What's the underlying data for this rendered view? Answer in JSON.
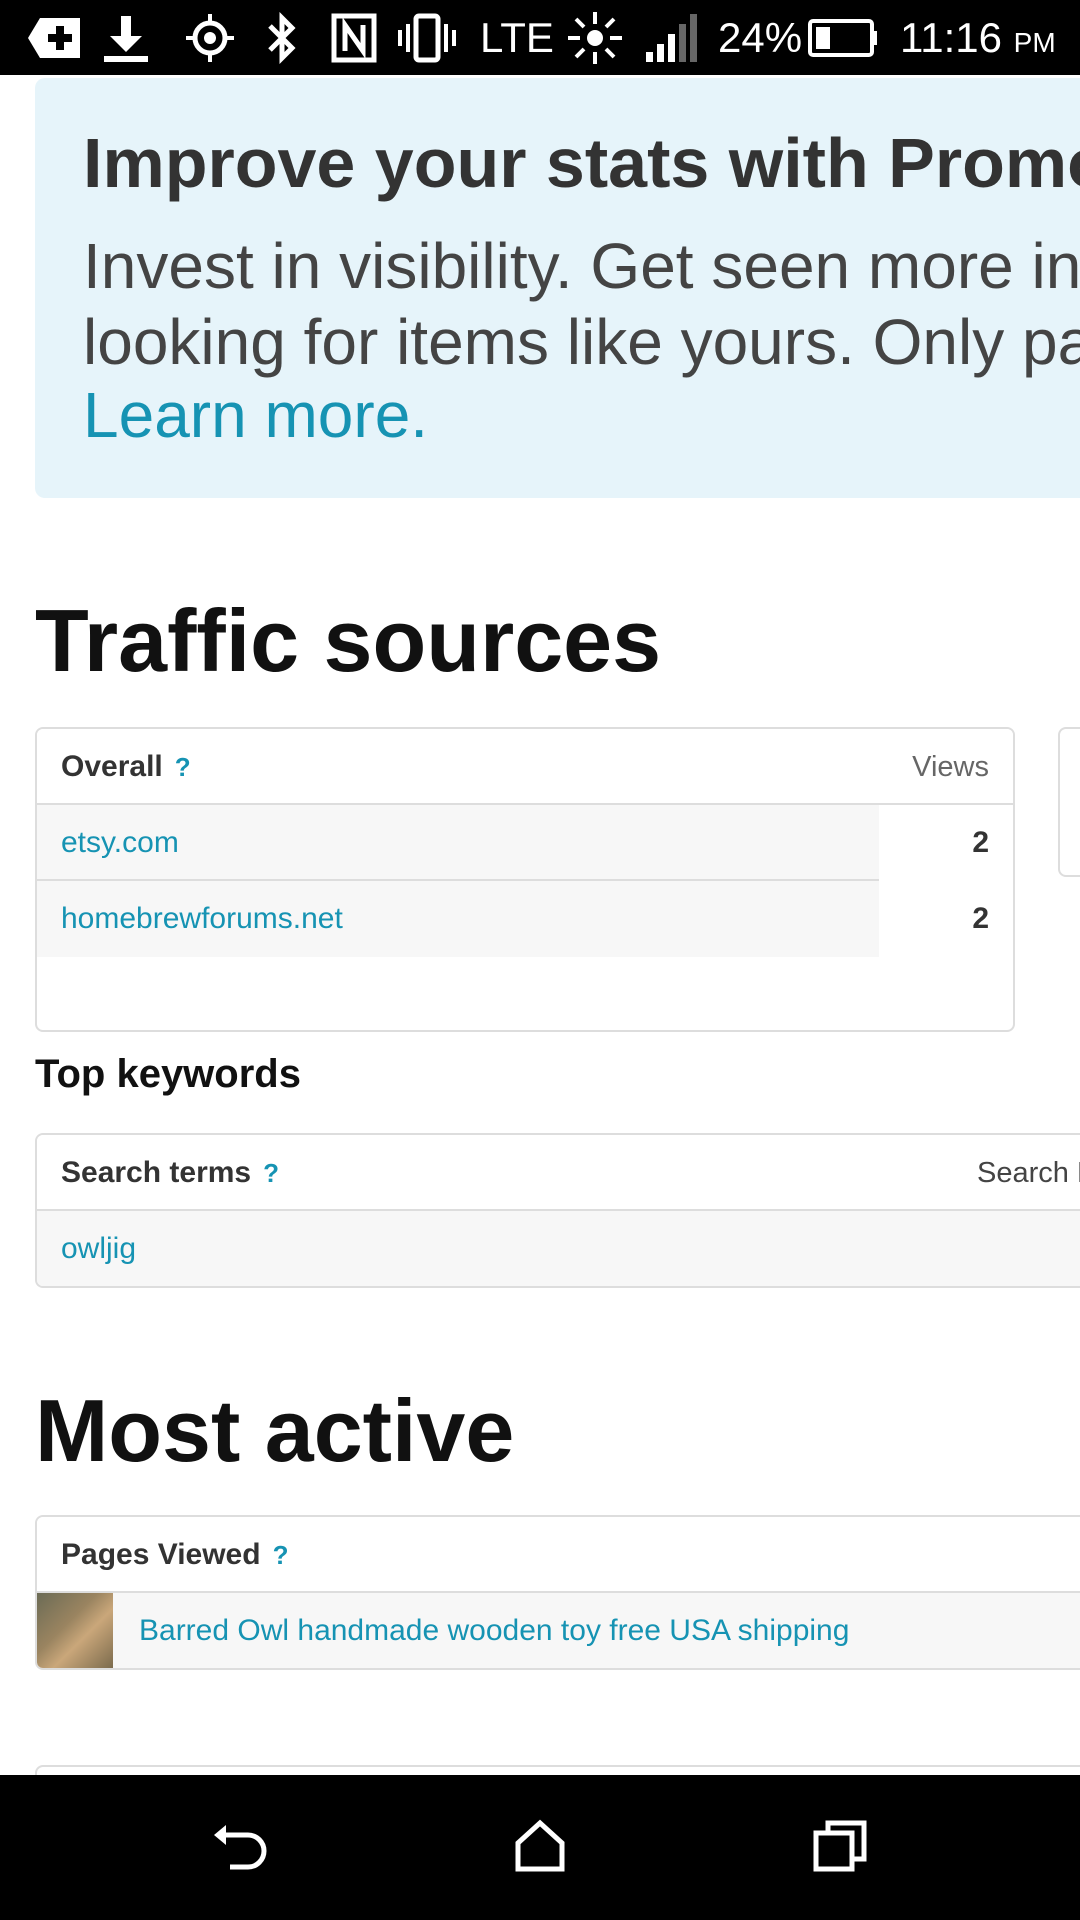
{
  "status_bar": {
    "battery": "24%",
    "network": "LTE",
    "time": "11:16",
    "ampm": "PM",
    "icons": [
      "add-notification-icon",
      "download-icon",
      "gps-icon",
      "bluetooth-icon",
      "nfc-icon",
      "vibrate-icon",
      "lte-icon",
      "brightness-icon",
      "signal-icon",
      "battery-icon"
    ]
  },
  "promo": {
    "title": "Improve your stats with Promoted Listings",
    "body_line1": "Invest in visibility. Get seen more in search by shoppers",
    "body_line2": "looking for items like yours. Only pay when they click.",
    "link": "Learn more."
  },
  "traffic_sources": {
    "title": "Traffic sources",
    "overall_label": "Overall",
    "views_label": "Views",
    "rows": [
      {
        "source": "etsy.com",
        "views": "2"
      },
      {
        "source": "homebrewforums.net",
        "views": "2"
      }
    ]
  },
  "top_keywords": {
    "title": "Top keywords",
    "search_terms_label": "Search terms",
    "search_right_label": "Search E",
    "rows": [
      {
        "term": "owljig"
      }
    ]
  },
  "most_active": {
    "title": "Most active",
    "pages_viewed_label": "Pages Viewed",
    "rows": [
      {
        "title": "Barred Owl handmade wooden toy free USA shipping"
      }
    ]
  },
  "help_glyph": "?",
  "colors": {
    "accent": "#1693b3",
    "promo_bg": "#e6f4fa",
    "border": "#dddddd",
    "row_bg": "#f7f7f7"
  }
}
